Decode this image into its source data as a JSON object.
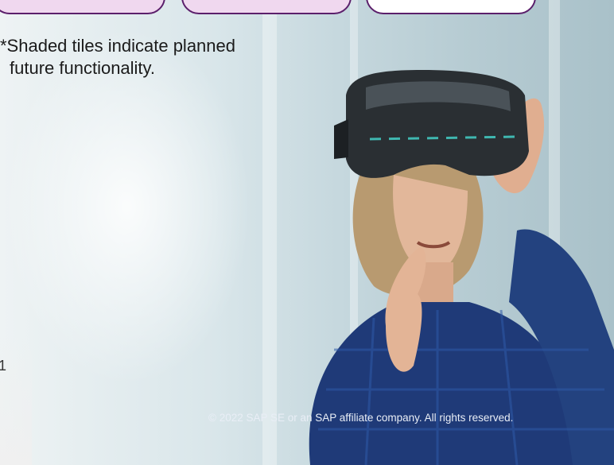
{
  "tiles": [
    {
      "name": "tile-1",
      "state": "shaded"
    },
    {
      "name": "tile-2",
      "state": "shaded"
    },
    {
      "name": "tile-3",
      "state": "plain"
    }
  ],
  "colors": {
    "tile_border": "#5b1f6b",
    "tile_shaded": "#f0d8ef",
    "shirt": "#1f3a78",
    "headset": "#2a2f33"
  },
  "footnote": {
    "line1": "*Shaded tiles indicate planned",
    "line2": "future functionality."
  },
  "edge_char": "1",
  "copyright": "© 2022 SAP SE or an SAP affiliate company. All rights reserved."
}
